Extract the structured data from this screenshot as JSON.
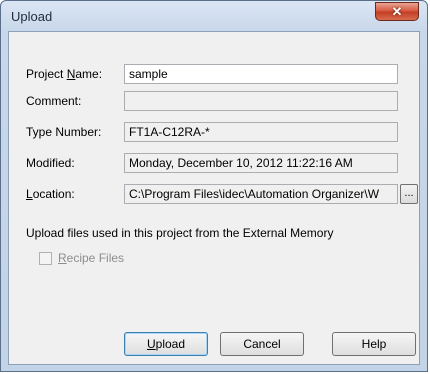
{
  "window": {
    "title": "Upload"
  },
  "labels": {
    "project_name_pre": "Project ",
    "project_name_u": "N",
    "project_name_post": "ame:",
    "comment": "Comment:",
    "type_number": "Type Number:",
    "modified": "Modified:",
    "location_u": "L",
    "location_post": "ocation:"
  },
  "fields": {
    "project_name": "sample",
    "comment": "",
    "type_number": "FT1A-C12RA-*",
    "modified": "Monday, December 10, 2012 11:22:16 AM",
    "location": "C:\\Program Files\\idec\\Automation Organizer\\W"
  },
  "browse_label": "...",
  "upload_section": {
    "description": "Upload files used in this project from the External Memory",
    "recipe_u": "R",
    "recipe_post": "ecipe Files",
    "recipe_checked": false
  },
  "buttons": {
    "upload_u": "U",
    "upload_post": "pload",
    "cancel": "Cancel",
    "help": "Help"
  },
  "icons": {
    "close": "close-icon"
  }
}
